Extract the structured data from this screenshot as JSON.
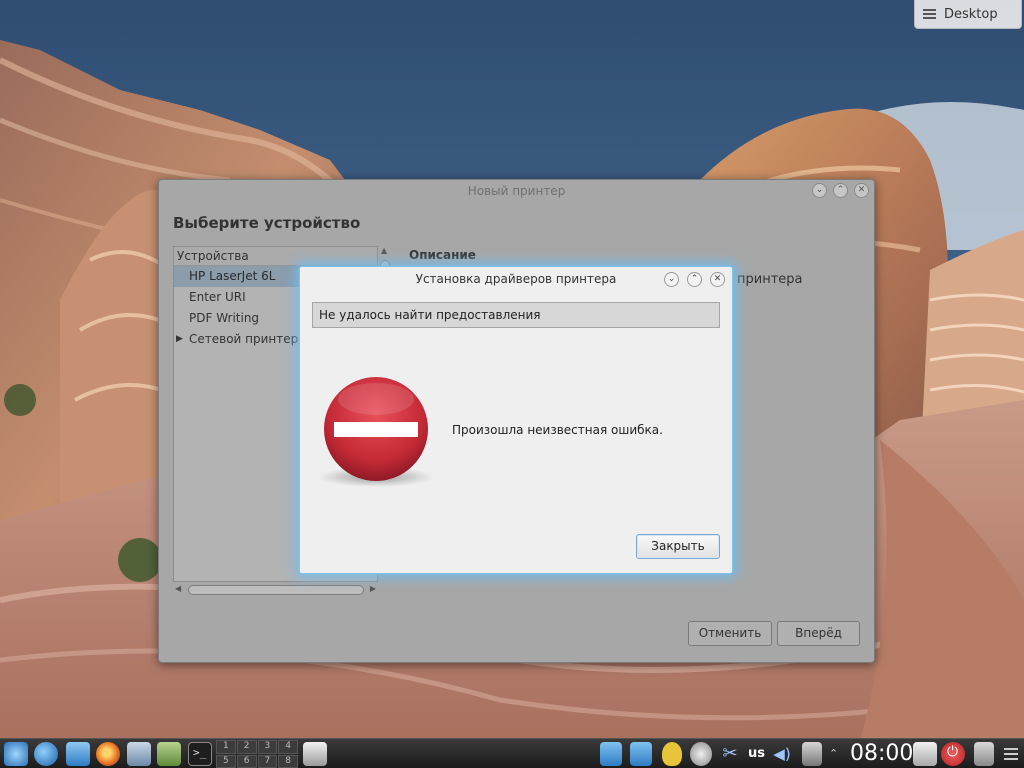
{
  "desktop": {
    "button_label": "Desktop"
  },
  "main_window": {
    "title": "Новый принтер",
    "heading": "Выберите устройство",
    "list_header": "Устройства",
    "devices": [
      "HP LaserJet 6L",
      "Enter URI",
      "PDF Writing",
      "Сетевой принтер"
    ],
    "description_label": "Описание",
    "description_trailing": "принтера",
    "cancel_label": "Отменить",
    "forward_label": "Вперёд"
  },
  "error_dialog": {
    "title": "Установка драйверов принтера",
    "header": "Не удалось найти предоставления",
    "message": "Произошла неизвестная ошибка.",
    "close_label": "Закрыть"
  },
  "taskbar": {
    "pager": [
      "1",
      "2",
      "3",
      "4",
      "5",
      "6",
      "7",
      "8"
    ],
    "keyboard_layout": "us",
    "clock": "08:00"
  },
  "colors": {
    "accent_glow": "#6ebef0",
    "stop_red": "#c42a36",
    "selection": "#8b9cab"
  },
  "icons": [
    "menu-icon",
    "minimize-icon",
    "maximize-icon",
    "close-icon",
    "stop-icon",
    "app-launcher-icon",
    "firefox-icon",
    "terminal-icon",
    "printer-icon",
    "volume-icon",
    "lock-icon",
    "power-icon",
    "trash-icon"
  ]
}
